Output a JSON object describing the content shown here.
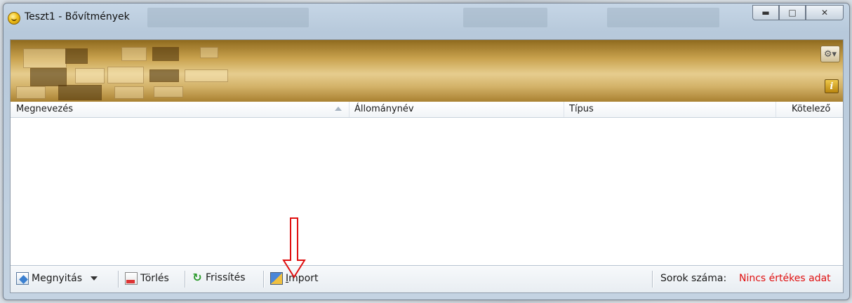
{
  "window": {
    "title": "Teszt1 - Bővítmények",
    "controls": [
      "minimize",
      "maximize",
      "close"
    ]
  },
  "banner": {
    "settings_icon": "gear-icon",
    "info_icon": "info-icon",
    "info_label": "i"
  },
  "grid": {
    "columns": [
      {
        "label": "Megnevezés",
        "sorted": "ascending"
      },
      {
        "label": "Állománynév"
      },
      {
        "label": "Típus"
      },
      {
        "label": "Kötelező"
      }
    ],
    "rows": []
  },
  "toolbar": {
    "open_label": "Megnyitás",
    "delete_label": "Törlés",
    "refresh_label": "Frissítés",
    "import_label": "Import",
    "import_mnemonic": "I",
    "import_rest": "mport"
  },
  "status": {
    "rows_label": "Sorok száma:",
    "rows_value": "Nincs értékes adat",
    "value_color": "#e01010"
  },
  "annotation": {
    "arrow_color": "#e01010",
    "target": "import-button"
  }
}
